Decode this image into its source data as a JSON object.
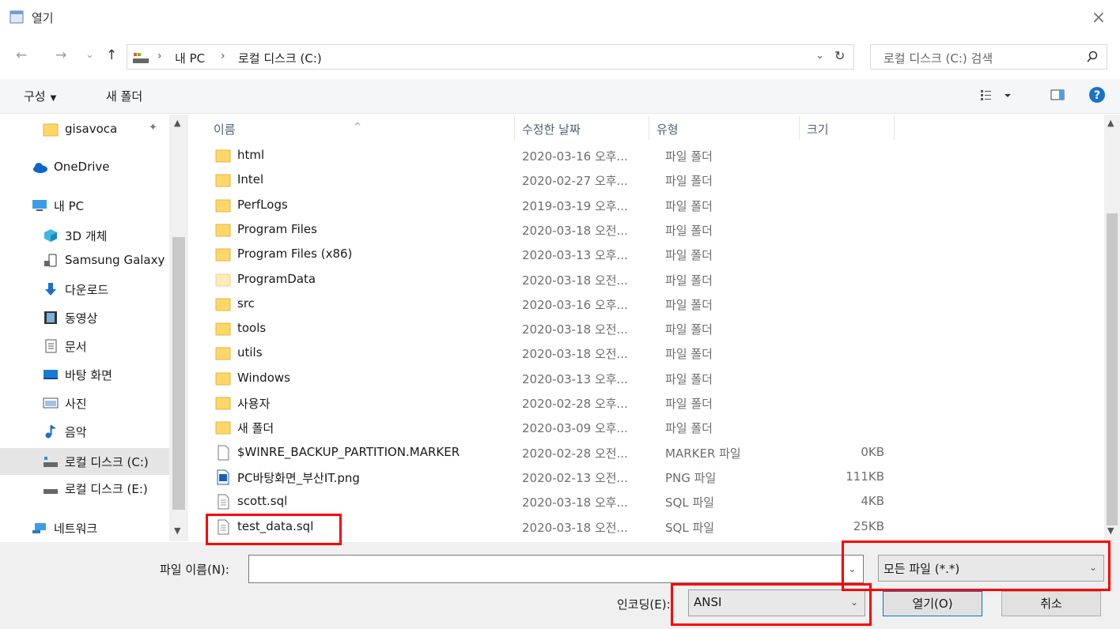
{
  "window": {
    "title": "열기",
    "close_glyph": "×"
  },
  "nav": {
    "back": "←",
    "forward": "→",
    "recent": "⌄",
    "up": "↑",
    "breadcrumbs": [
      "내 PC",
      "로컬 디스크 (C:)"
    ],
    "sep": "›",
    "search_placeholder": "로컬 디스크 (C:) 검색"
  },
  "toolbar": {
    "organize": "구성",
    "new_folder": "새 폴더",
    "help": "?"
  },
  "sidebar": {
    "items": [
      {
        "label": "gisavoca",
        "icon": "folder-icon"
      },
      {
        "label": "OneDrive",
        "icon": "cloud-icon"
      },
      {
        "label": "내 PC",
        "icon": "computer-icon"
      },
      {
        "label": "3D 개체",
        "icon": "cube-icon"
      },
      {
        "label": "Samsung Galaxy",
        "icon": "phone-icon"
      },
      {
        "label": "다운로드",
        "icon": "download-icon"
      },
      {
        "label": "동영상",
        "icon": "video-icon"
      },
      {
        "label": "문서",
        "icon": "document-icon"
      },
      {
        "label": "바탕 화면",
        "icon": "desktop-icon"
      },
      {
        "label": "사진",
        "icon": "picture-icon"
      },
      {
        "label": "음악",
        "icon": "music-icon"
      },
      {
        "label": "로컬 디스크 (C:)",
        "icon": "drive-icon"
      },
      {
        "label": "로컬 디스크 (E:)",
        "icon": "drive-icon"
      },
      {
        "label": "네트워크",
        "icon": "network-icon"
      }
    ]
  },
  "columns": {
    "name": "이름",
    "modified": "수정한 날짜",
    "type": "유형",
    "size": "크기"
  },
  "files": [
    {
      "name": "html",
      "date": "2020-03-16 오후...",
      "type": "파일 폴더",
      "size": "",
      "icon": "folder-icon"
    },
    {
      "name": "Intel",
      "date": "2020-02-27 오후...",
      "type": "파일 폴더",
      "size": "",
      "icon": "folder-icon"
    },
    {
      "name": "PerfLogs",
      "date": "2019-03-19 오후...",
      "type": "파일 폴더",
      "size": "",
      "icon": "folder-icon"
    },
    {
      "name": "Program Files",
      "date": "2020-03-18 오전...",
      "type": "파일 폴더",
      "size": "",
      "icon": "folder-icon"
    },
    {
      "name": "Program Files (x86)",
      "date": "2020-03-13 오후...",
      "type": "파일 폴더",
      "size": "",
      "icon": "folder-icon"
    },
    {
      "name": "ProgramData",
      "date": "2020-03-18 오전...",
      "type": "파일 폴더",
      "size": "",
      "icon": "folder-hidden-icon"
    },
    {
      "name": "src",
      "date": "2020-03-16 오후...",
      "type": "파일 폴더",
      "size": "",
      "icon": "folder-icon"
    },
    {
      "name": "tools",
      "date": "2020-03-18 오전...",
      "type": "파일 폴더",
      "size": "",
      "icon": "folder-icon"
    },
    {
      "name": "utils",
      "date": "2020-03-18 오전...",
      "type": "파일 폴더",
      "size": "",
      "icon": "folder-icon"
    },
    {
      "name": "Windows",
      "date": "2020-03-13 오후...",
      "type": "파일 폴더",
      "size": "",
      "icon": "folder-icon"
    },
    {
      "name": "사용자",
      "date": "2020-02-28 오후...",
      "type": "파일 폴더",
      "size": "",
      "icon": "folder-icon"
    },
    {
      "name": "새 폴더",
      "date": "2020-03-09 오후...",
      "type": "파일 폴더",
      "size": "",
      "icon": "folder-icon"
    },
    {
      "name": "$WINRE_BACKUP_PARTITION.MARKER",
      "date": "2020-02-28 오전...",
      "type": "MARKER 파일",
      "size": "0KB",
      "icon": "file-icon"
    },
    {
      "name": "PC바탕화면_부산IT.png",
      "date": "2020-02-13 오전...",
      "type": "PNG 파일",
      "size": "111KB",
      "icon": "image-file-icon"
    },
    {
      "name": "scott.sql",
      "date": "2020-03-18 오후...",
      "type": "SQL 파일",
      "size": "4KB",
      "icon": "text-file-icon"
    },
    {
      "name": "test_data.sql",
      "date": "2020-03-18 오전...",
      "type": "SQL 파일",
      "size": "25KB",
      "icon": "text-file-icon"
    }
  ],
  "bottom": {
    "filename_label": "파일 이름(N):",
    "filename_value": "",
    "filter_value": "모든 파일 (*.*)",
    "encoding_label": "인코딩(E):",
    "encoding_value": "ANSI",
    "open_button": "열기(O)",
    "cancel_button": "취소"
  },
  "colors": {
    "highlight": "#ff0000",
    "folder": "#ffd766",
    "accent": "#0078d7"
  }
}
